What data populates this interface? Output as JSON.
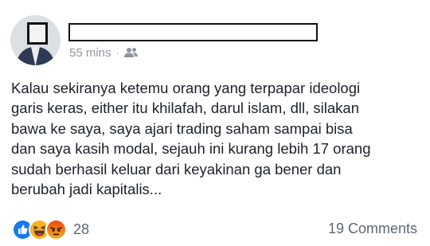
{
  "post": {
    "timestamp": "55 mins",
    "separator": "·",
    "privacy_icon": "friends-icon",
    "body": "Kalau sekiranya ketemu orang yang terpapar ideologi\ngaris keras, either itu khilafah, darul islam, dll, silakan\nbawa ke saya, saya ajari trading saham sampai bisa\ndan saya kasih modal, sejauh ini kurang lebih 17 orang\nsudah berhasil keluar dari keyakinan ga bener dan\nberubah jadi kapitalis..."
  },
  "footer": {
    "reaction_icons": [
      "like-icon",
      "haha-icon",
      "angry-icon"
    ],
    "reaction_count": "28",
    "comments_label": "19 Comments"
  },
  "colors": {
    "like": "#1877f2",
    "haha": "#f7b125",
    "angry": "#e9710f",
    "meta": "#90949c"
  }
}
